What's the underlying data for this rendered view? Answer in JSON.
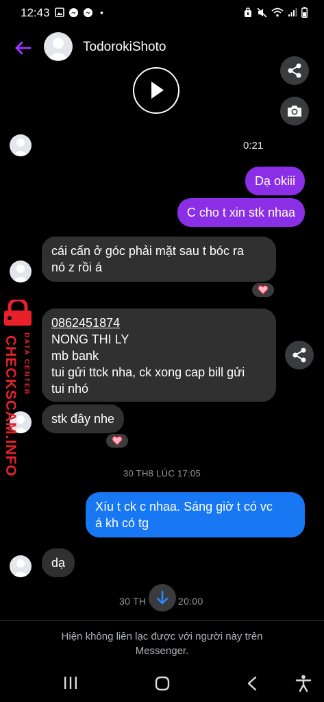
{
  "status_bar": {
    "time": "12:43",
    "dot": "•"
  },
  "header": {
    "contact_name": "TodorokiShoto"
  },
  "media": {
    "video_duration": "0:21"
  },
  "messages": {
    "out_1": "Dạ okiii",
    "out_2": "C cho t xin stk nhaa",
    "in_1_line1": "cái cấn ở góc phải mặt sau t bóc ra",
    "in_1_line2": "nó z rồi á",
    "in_2_phone": "0862451874",
    "in_2_line2": "NONG THI LY",
    "in_2_line3": "mb bank",
    "in_2_line4": "tui gửi ttck nha, ck xong cap bill gửi",
    "in_2_line5": "tui nhó",
    "in_3": "stk đây nhe",
    "out_3_line1": "Xíu t ck c nhaa. Sáng giờ t có vc",
    "out_3_line2": "á kh có tg",
    "in_4": "dạ"
  },
  "timestamps": {
    "t1": "30 TH8 LÚC 17:05",
    "t2_left": "30 TH",
    "t2_right": "20:00"
  },
  "footer": {
    "notice_line1": "Hiện không liên lạc được với người này trên",
    "notice_line2": "Messenger."
  },
  "watermark": {
    "brand": "CHECKSCAM.INFO",
    "sub": "DATA CENTER"
  },
  "colors": {
    "outgoing_bubble": "#8b2fe6",
    "incoming_bubble": "#303030",
    "blue_bubble": "#1877f2",
    "accent_back": "#a033ff",
    "watermark_red": "#e8202a"
  }
}
